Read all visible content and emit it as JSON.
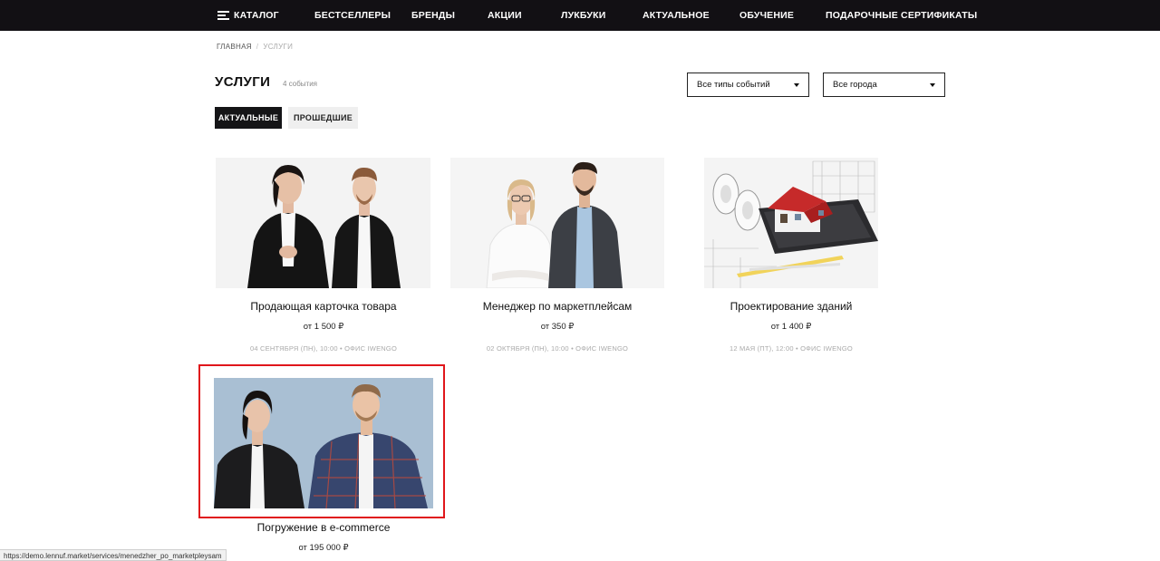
{
  "nav": {
    "catalog": "КАТАЛОГ",
    "items": [
      "БЕСТСЕЛЛЕРЫ",
      "БРЕНДЫ",
      "АКЦИИ",
      "ЛУКБУКИ",
      "АКТУАЛЬНОЕ",
      "ОБУЧЕНИЕ",
      "ПОДАРОЧНЫЕ СЕРТИФИКАТЫ"
    ]
  },
  "breadcrumb": {
    "home": "ГЛАВНАЯ",
    "separator": "/",
    "current": "УСЛУГИ"
  },
  "page": {
    "title": "УСЛУГИ",
    "count": "4 события"
  },
  "filters": {
    "event_type": "Все типы событий",
    "city": "Все города"
  },
  "tabs": {
    "active": "АКТУАЛЬНЫЕ",
    "past": "ПРОШЕДШИЕ"
  },
  "cards": [
    {
      "title": "Продающая карточка товара",
      "price": "от 1 500 ₽",
      "meta": "04 СЕНТЯБРЯ (ПН), 10:00 • ОФИС IWENGO"
    },
    {
      "title": "Менеджер по маркетплейсам",
      "price": "от 350 ₽",
      "meta": "02 ОКТЯБРЯ (ПН), 10:00 • ОФИС IWENGO"
    },
    {
      "title": "Проектирование зданий",
      "price": "от 1 400 ₽",
      "meta": "12 МАЯ (ПТ), 12:00 • ОФИС IWENGO"
    },
    {
      "title": "Погружение в e-commerce",
      "price": "от 195 000 ₽",
      "meta": ""
    }
  ],
  "status_bar": {
    "url": "https://demo.lennuf.market/services/menedzher_po_marketpleysam"
  },
  "colors": {
    "nav_bg": "#121014",
    "highlight": "#e0161b",
    "photo_bg_blue": "#a9bfd3"
  }
}
